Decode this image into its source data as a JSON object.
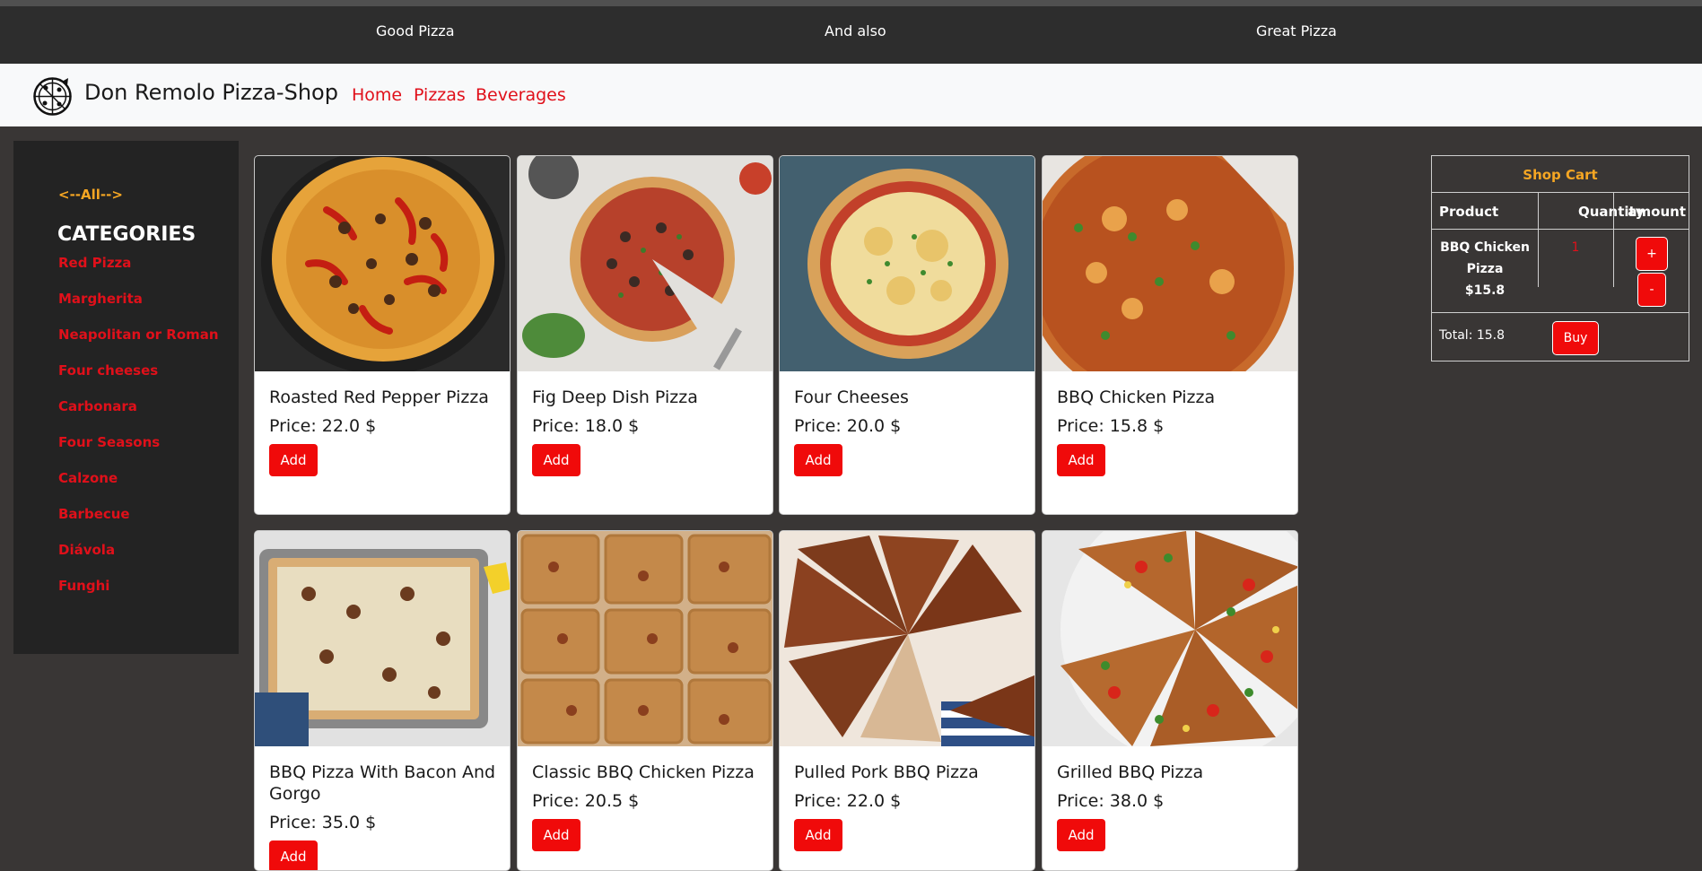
{
  "announcement": {
    "items": [
      "Good Pizza",
      "And also",
      "Great Pizza"
    ]
  },
  "navbar": {
    "brand": "Don Remolo Pizza-Shop",
    "links": [
      "Home",
      "Pizzas",
      "Beverages"
    ]
  },
  "sidebar": {
    "all_link": "<--All-->",
    "title": "CATEGORIES",
    "categories": [
      "Red Pizza",
      "Margherita",
      "Neapolitan or Roman",
      "Four cheeses",
      "Carbonara",
      "Four Seasons",
      "Calzone",
      "Barbecue",
      "Diávola",
      "Funghi"
    ]
  },
  "products": [
    {
      "name": "Roasted Red Pepper Pizza",
      "price": "Price: 22.0 $",
      "add_label": "Add"
    },
    {
      "name": "Fig Deep Dish Pizza",
      "price": "Price: 18.0 $",
      "add_label": "Add"
    },
    {
      "name": "Four Cheeses",
      "price": "Price: 20.0 $",
      "add_label": "Add"
    },
    {
      "name": "BBQ Chicken Pizza",
      "price": "Price: 15.8 $",
      "add_label": "Add"
    },
    {
      "name": "BBQ Pizza With Bacon And Gorgo",
      "price": "Price: 35.0 $",
      "add_label": "Add"
    },
    {
      "name": "Classic BBQ Chicken Pizza",
      "price": "Price: 20.5 $",
      "add_label": "Add"
    },
    {
      "name": "Pulled Pork BBQ Pizza",
      "price": "Price: 22.0 $",
      "add_label": "Add"
    },
    {
      "name": "Grilled BBQ Pizza",
      "price": "Price: 38.0 $",
      "add_label": "Add"
    }
  ],
  "cart": {
    "title": "Shop Cart",
    "headers": [
      "Product",
      "Quantity",
      "amount"
    ],
    "rows": [
      {
        "product": "BBQ Chicken Pizza",
        "price": "$15.8",
        "quantity": "1",
        "plus": "+",
        "minus": "-"
      }
    ],
    "total": "Total: 15.8",
    "buy_label": "Buy"
  },
  "colors": {
    "accent": "#f00a0a",
    "link": "#e0101a",
    "highlight": "#f5a623",
    "background": "#393635"
  }
}
